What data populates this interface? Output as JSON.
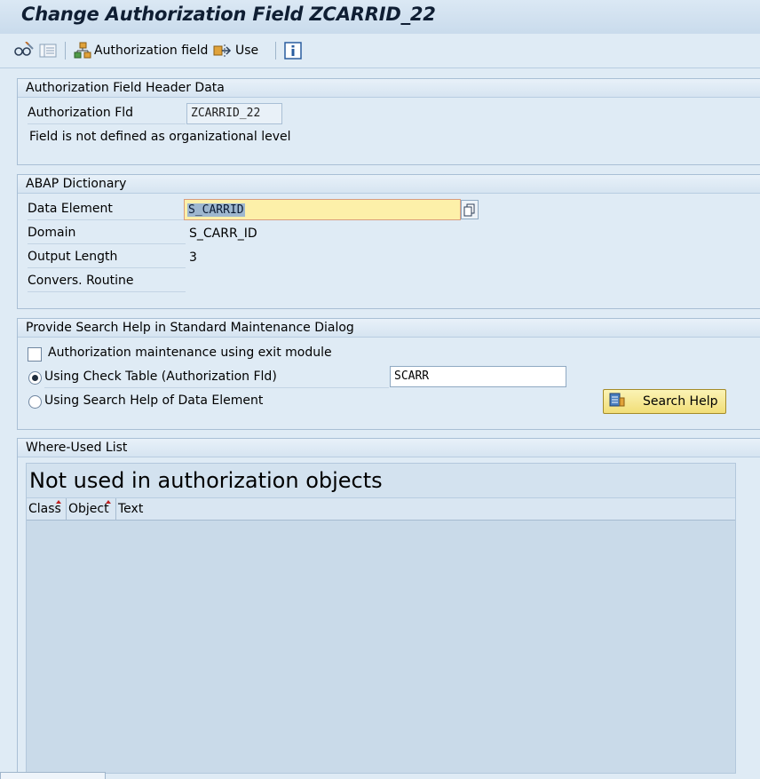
{
  "title": "Change Authorization Field ZCARRID_22",
  "toolbar": {
    "authorization_field_label": "Authorization field",
    "use_label": "Use"
  },
  "header_group": {
    "title": "Authorization Field Header Data",
    "auth_fld_label": "Authorization Fld",
    "auth_fld_value": "ZCARRID_22",
    "org_level_note": "Field is not defined as organizational level"
  },
  "dictionary_group": {
    "title": "ABAP Dictionary",
    "data_element_label": "Data Element",
    "data_element_value": "S_CARRID",
    "domain_label": "Domain",
    "domain_value": "S_CARR_ID",
    "output_length_label": "Output Length",
    "output_length_value": "3",
    "convers_routine_label": "Convers. Routine"
  },
  "search_help_group": {
    "title": "Provide Search Help in Standard Maintenance Dialog",
    "exit_module_label": "Authorization maintenance using exit module",
    "exit_module_checked": false,
    "check_table_label": "Using Check Table (Authorization Fld)",
    "check_table_value": "SCARR",
    "search_help_de_label": "Using Search Help of Data Element",
    "selected_option": "check_table",
    "search_help_button": "Search Help"
  },
  "where_used_group": {
    "title": "Where-Used List",
    "table_title": "Not used in authorization objects",
    "columns": [
      "Class",
      "Object",
      "Text"
    ],
    "rows": []
  },
  "colors": {
    "background": "#dfebf5",
    "focus_field": "#fdf0a9",
    "search_help_button": "#f1de77"
  }
}
